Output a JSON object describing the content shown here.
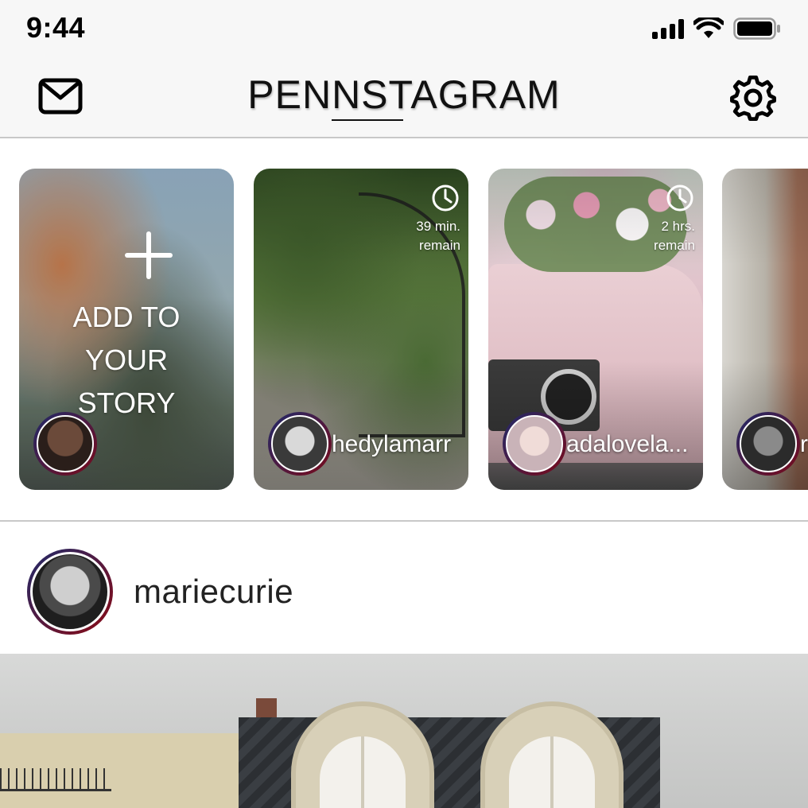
{
  "status_bar": {
    "time": "9:44",
    "icons": [
      "cellular-signal-icon",
      "wifi-icon",
      "battery-icon"
    ]
  },
  "nav": {
    "logo": "PENNSTAGRAM",
    "left_icon": "mail-icon",
    "right_icon": "gear-icon"
  },
  "stories": {
    "add_story": {
      "label_line1": "ADD TO",
      "label_line2": "YOUR",
      "label_line3": "STORY",
      "icon": "plus-icon"
    },
    "items": [
      {
        "username": "hedylamarr",
        "timer_line1": "39 min.",
        "timer_line2": "remain",
        "timer_icon": "clock-icon"
      },
      {
        "username": "adalovela...",
        "timer_line1": "2 hrs.",
        "timer_line2": "remain",
        "timer_icon": "clock-icon"
      },
      {
        "username": "r",
        "timer_line1": "",
        "timer_line2": "",
        "timer_icon": ""
      }
    ]
  },
  "post": {
    "username": "mariecurie"
  },
  "colors": {
    "ring_start": "#1f2a6a",
    "ring_end": "#8a0a14",
    "divider": "#c8c8c8",
    "bar_bg": "#f7f7f7"
  }
}
